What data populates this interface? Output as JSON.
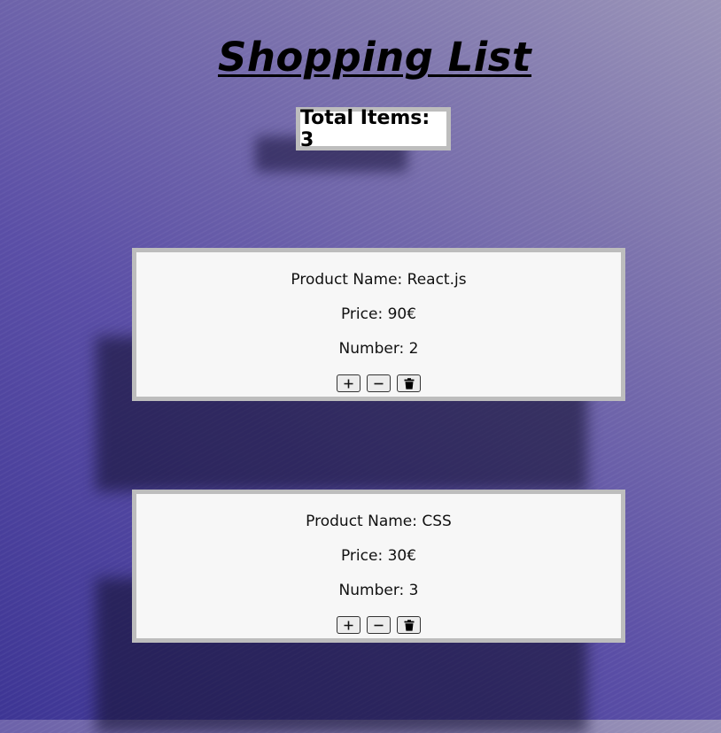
{
  "page": {
    "title": "Shopping List",
    "total_label": "Total Items: 3"
  },
  "products": [
    {
      "name_line": "Product Name: React.js",
      "price_line": "Price: 90€",
      "number_line": "Number: 2"
    },
    {
      "name_line": "Product Name: CSS",
      "price_line": "Price: 30€",
      "number_line": "Number: 3"
    }
  ],
  "buttons": {
    "increment_icon": "plus-icon",
    "decrement_icon": "minus-icon",
    "delete_icon": "trash-icon"
  },
  "colors": {
    "background_start": "#3d3594",
    "background_end": "#9a94b8",
    "card_border": "#bdbdbd",
    "card_background": "#f7f7f7"
  }
}
